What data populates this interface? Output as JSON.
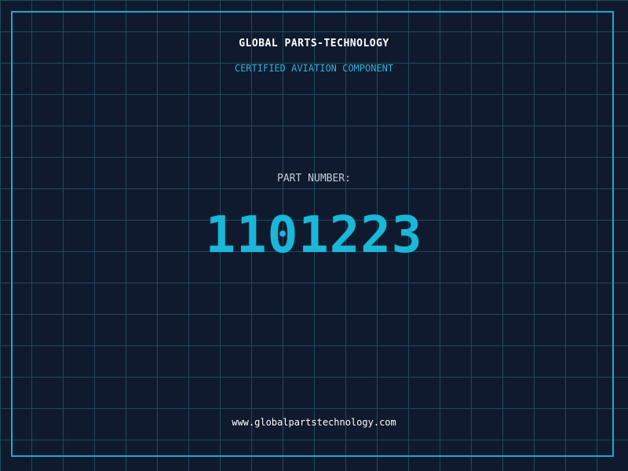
{
  "header": {
    "company": "GLOBAL PARTS-TECHNOLOGY",
    "tagline": "CERTIFIED AVIATION COMPONENT"
  },
  "part": {
    "label": "PART NUMBER:",
    "number": "1101223"
  },
  "footer": {
    "website": "www.globalpartstechnology.com"
  },
  "colors": {
    "background": "#101a2e",
    "grid": "#1d4a5e",
    "frame": "#22a8cc",
    "accent": "#1ab7d8",
    "tagline": "#2fb0d8"
  }
}
